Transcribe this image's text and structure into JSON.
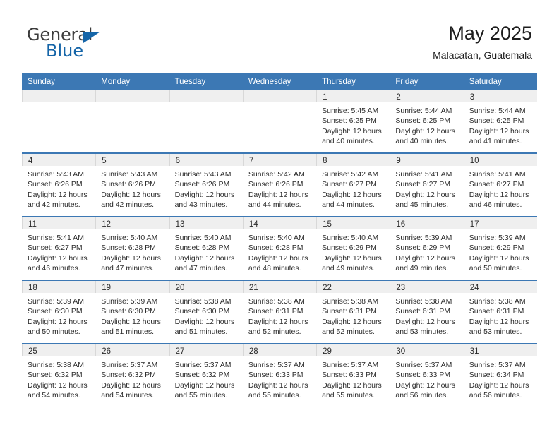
{
  "brand": {
    "name_top": "General",
    "name_bottom": "Blue",
    "accent_color": "#1565a8",
    "triangle_icon": "brand-triangle-icon"
  },
  "header": {
    "title": "May 2025",
    "subtitle": "Malacatan, Guatemala"
  },
  "colors": {
    "header_blue": "#3c78b4",
    "daynum_gray": "#efefef",
    "text": "#2b2b2b",
    "cell_border": "#d8d8d8"
  },
  "weekday_headers": [
    "Sunday",
    "Monday",
    "Tuesday",
    "Wednesday",
    "Thursday",
    "Friday",
    "Saturday"
  ],
  "labels": {
    "sunrise_prefix": "Sunrise:",
    "sunset_prefix": "Sunset:",
    "daylight_prefix": "Daylight:"
  },
  "weeks": [
    [
      {
        "day": "",
        "empty": true,
        "line1": "",
        "line2": "",
        "line3": "",
        "line4": ""
      },
      {
        "day": "",
        "empty": true,
        "line1": "",
        "line2": "",
        "line3": "",
        "line4": ""
      },
      {
        "day": "",
        "empty": true,
        "line1": "",
        "line2": "",
        "line3": "",
        "line4": ""
      },
      {
        "day": "",
        "empty": true,
        "line1": "",
        "line2": "",
        "line3": "",
        "line4": ""
      },
      {
        "day": "1",
        "empty": false,
        "line1": "Sunrise: 5:45 AM",
        "line2": "Sunset: 6:25 PM",
        "line3": "Daylight: 12 hours",
        "line4": "and 40 minutes."
      },
      {
        "day": "2",
        "empty": false,
        "line1": "Sunrise: 5:44 AM",
        "line2": "Sunset: 6:25 PM",
        "line3": "Daylight: 12 hours",
        "line4": "and 40 minutes."
      },
      {
        "day": "3",
        "empty": false,
        "line1": "Sunrise: 5:44 AM",
        "line2": "Sunset: 6:25 PM",
        "line3": "Daylight: 12 hours",
        "line4": "and 41 minutes."
      }
    ],
    [
      {
        "day": "4",
        "empty": false,
        "line1": "Sunrise: 5:43 AM",
        "line2": "Sunset: 6:26 PM",
        "line3": "Daylight: 12 hours",
        "line4": "and 42 minutes."
      },
      {
        "day": "5",
        "empty": false,
        "line1": "Sunrise: 5:43 AM",
        "line2": "Sunset: 6:26 PM",
        "line3": "Daylight: 12 hours",
        "line4": "and 42 minutes."
      },
      {
        "day": "6",
        "empty": false,
        "line1": "Sunrise: 5:43 AM",
        "line2": "Sunset: 6:26 PM",
        "line3": "Daylight: 12 hours",
        "line4": "and 43 minutes."
      },
      {
        "day": "7",
        "empty": false,
        "line1": "Sunrise: 5:42 AM",
        "line2": "Sunset: 6:26 PM",
        "line3": "Daylight: 12 hours",
        "line4": "and 44 minutes."
      },
      {
        "day": "8",
        "empty": false,
        "line1": "Sunrise: 5:42 AM",
        "line2": "Sunset: 6:27 PM",
        "line3": "Daylight: 12 hours",
        "line4": "and 44 minutes."
      },
      {
        "day": "9",
        "empty": false,
        "line1": "Sunrise: 5:41 AM",
        "line2": "Sunset: 6:27 PM",
        "line3": "Daylight: 12 hours",
        "line4": "and 45 minutes."
      },
      {
        "day": "10",
        "empty": false,
        "line1": "Sunrise: 5:41 AM",
        "line2": "Sunset: 6:27 PM",
        "line3": "Daylight: 12 hours",
        "line4": "and 46 minutes."
      }
    ],
    [
      {
        "day": "11",
        "empty": false,
        "line1": "Sunrise: 5:41 AM",
        "line2": "Sunset: 6:27 PM",
        "line3": "Daylight: 12 hours",
        "line4": "and 46 minutes."
      },
      {
        "day": "12",
        "empty": false,
        "line1": "Sunrise: 5:40 AM",
        "line2": "Sunset: 6:28 PM",
        "line3": "Daylight: 12 hours",
        "line4": "and 47 minutes."
      },
      {
        "day": "13",
        "empty": false,
        "line1": "Sunrise: 5:40 AM",
        "line2": "Sunset: 6:28 PM",
        "line3": "Daylight: 12 hours",
        "line4": "and 47 minutes."
      },
      {
        "day": "14",
        "empty": false,
        "line1": "Sunrise: 5:40 AM",
        "line2": "Sunset: 6:28 PM",
        "line3": "Daylight: 12 hours",
        "line4": "and 48 minutes."
      },
      {
        "day": "15",
        "empty": false,
        "line1": "Sunrise: 5:40 AM",
        "line2": "Sunset: 6:29 PM",
        "line3": "Daylight: 12 hours",
        "line4": "and 49 minutes."
      },
      {
        "day": "16",
        "empty": false,
        "line1": "Sunrise: 5:39 AM",
        "line2": "Sunset: 6:29 PM",
        "line3": "Daylight: 12 hours",
        "line4": "and 49 minutes."
      },
      {
        "day": "17",
        "empty": false,
        "line1": "Sunrise: 5:39 AM",
        "line2": "Sunset: 6:29 PM",
        "line3": "Daylight: 12 hours",
        "line4": "and 50 minutes."
      }
    ],
    [
      {
        "day": "18",
        "empty": false,
        "line1": "Sunrise: 5:39 AM",
        "line2": "Sunset: 6:30 PM",
        "line3": "Daylight: 12 hours",
        "line4": "and 50 minutes."
      },
      {
        "day": "19",
        "empty": false,
        "line1": "Sunrise: 5:39 AM",
        "line2": "Sunset: 6:30 PM",
        "line3": "Daylight: 12 hours",
        "line4": "and 51 minutes."
      },
      {
        "day": "20",
        "empty": false,
        "line1": "Sunrise: 5:38 AM",
        "line2": "Sunset: 6:30 PM",
        "line3": "Daylight: 12 hours",
        "line4": "and 51 minutes."
      },
      {
        "day": "21",
        "empty": false,
        "line1": "Sunrise: 5:38 AM",
        "line2": "Sunset: 6:31 PM",
        "line3": "Daylight: 12 hours",
        "line4": "and 52 minutes."
      },
      {
        "day": "22",
        "empty": false,
        "line1": "Sunrise: 5:38 AM",
        "line2": "Sunset: 6:31 PM",
        "line3": "Daylight: 12 hours",
        "line4": "and 52 minutes."
      },
      {
        "day": "23",
        "empty": false,
        "line1": "Sunrise: 5:38 AM",
        "line2": "Sunset: 6:31 PM",
        "line3": "Daylight: 12 hours",
        "line4": "and 53 minutes."
      },
      {
        "day": "24",
        "empty": false,
        "line1": "Sunrise: 5:38 AM",
        "line2": "Sunset: 6:31 PM",
        "line3": "Daylight: 12 hours",
        "line4": "and 53 minutes."
      }
    ],
    [
      {
        "day": "25",
        "empty": false,
        "line1": "Sunrise: 5:38 AM",
        "line2": "Sunset: 6:32 PM",
        "line3": "Daylight: 12 hours",
        "line4": "and 54 minutes."
      },
      {
        "day": "26",
        "empty": false,
        "line1": "Sunrise: 5:37 AM",
        "line2": "Sunset: 6:32 PM",
        "line3": "Daylight: 12 hours",
        "line4": "and 54 minutes."
      },
      {
        "day": "27",
        "empty": false,
        "line1": "Sunrise: 5:37 AM",
        "line2": "Sunset: 6:32 PM",
        "line3": "Daylight: 12 hours",
        "line4": "and 55 minutes."
      },
      {
        "day": "28",
        "empty": false,
        "line1": "Sunrise: 5:37 AM",
        "line2": "Sunset: 6:33 PM",
        "line3": "Daylight: 12 hours",
        "line4": "and 55 minutes."
      },
      {
        "day": "29",
        "empty": false,
        "line1": "Sunrise: 5:37 AM",
        "line2": "Sunset: 6:33 PM",
        "line3": "Daylight: 12 hours",
        "line4": "and 55 minutes."
      },
      {
        "day": "30",
        "empty": false,
        "line1": "Sunrise: 5:37 AM",
        "line2": "Sunset: 6:33 PM",
        "line3": "Daylight: 12 hours",
        "line4": "and 56 minutes."
      },
      {
        "day": "31",
        "empty": false,
        "line1": "Sunrise: 5:37 AM",
        "line2": "Sunset: 6:34 PM",
        "line3": "Daylight: 12 hours",
        "line4": "and 56 minutes."
      }
    ]
  ]
}
